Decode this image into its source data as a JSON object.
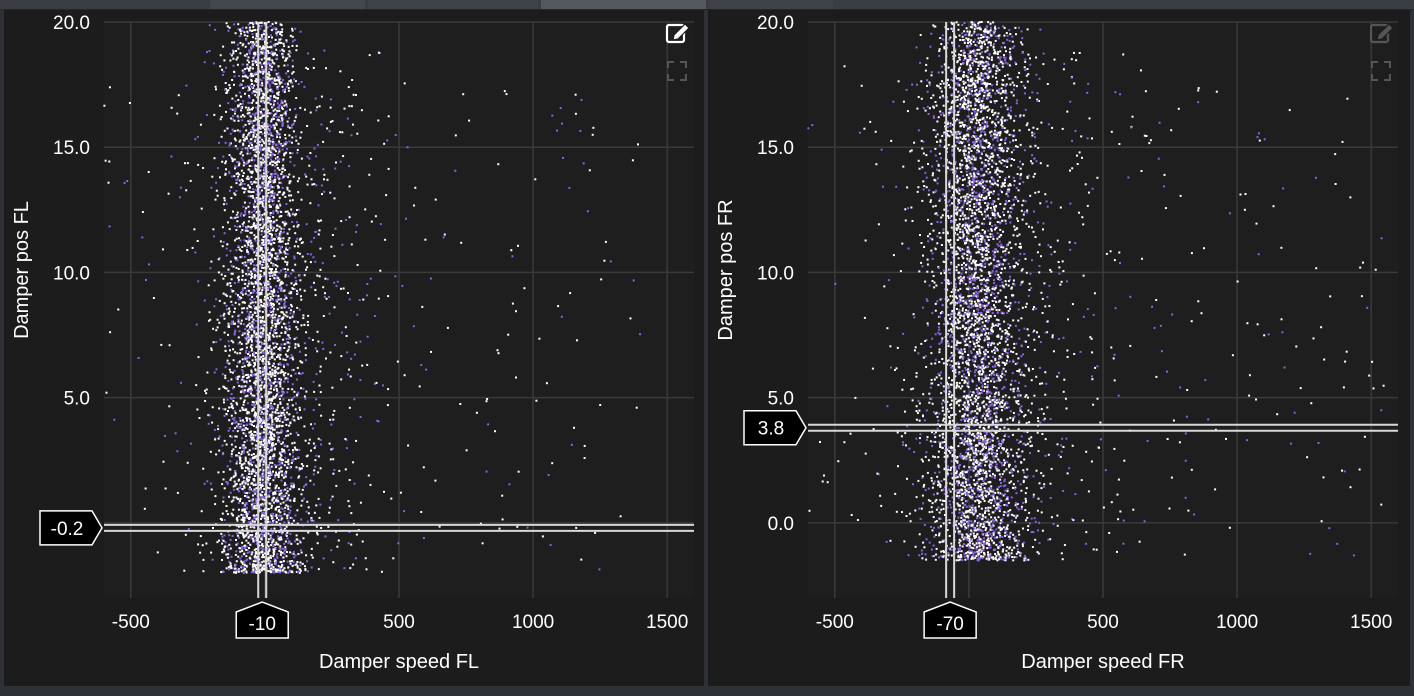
{
  "colors": {
    "background": "#1c1c1c",
    "grid": "#3a3a3a",
    "text": "#ffffff",
    "point_primary": "#ffffff",
    "point_secondary": "#8a63e0",
    "cursor_line": "#d8d8d8"
  },
  "toolbar_icons": [
    "edit-icon",
    "fullscreen-icon"
  ],
  "chart_data": [
    {
      "type": "scatter",
      "xlabel": "Damper speed FL",
      "ylabel": "Damper pos FL",
      "xlim": [
        -600,
        1600
      ],
      "ylim": [
        -3,
        20
      ],
      "xticks": [
        -500,
        0,
        500,
        1000,
        1500
      ],
      "xtick_labels": [
        "-500",
        "",
        "500",
        "1000",
        "1500"
      ],
      "yticks": [
        0,
        5,
        10,
        15,
        20
      ],
      "ytick_labels": [
        "",
        "5.0",
        "10.0",
        "15.0",
        "20.0"
      ],
      "grid": true,
      "cursor": {
        "x": -10,
        "y": -0.2,
        "x_label": "-10",
        "y_label": "-0.2"
      },
      "distribution": {
        "center_x": -10,
        "spread_x": 60,
        "y_min": -2,
        "y_max": 20,
        "outlier_x_max": 1400
      },
      "series": [
        {
          "color": "#ffffff"
        },
        {
          "color": "#8a63e0"
        }
      ]
    },
    {
      "type": "scatter",
      "xlabel": "Damper speed FR",
      "ylabel": "Damper pos FR",
      "xlim": [
        -600,
        1600
      ],
      "ylim": [
        -3,
        20
      ],
      "xticks": [
        -500,
        0,
        500,
        1000,
        1500
      ],
      "xtick_labels": [
        "-500",
        "",
        "500",
        "1000",
        "1500"
      ],
      "yticks": [
        0,
        5,
        10,
        15,
        20
      ],
      "ytick_labels": [
        "0.0",
        "5.0",
        "10.0",
        "15.0",
        "20.0"
      ],
      "grid": true,
      "cursor": {
        "x": -70,
        "y": 3.8,
        "x_label": "-70",
        "y_label": "3.8"
      },
      "distribution": {
        "center_x": 30,
        "spread_x": 80,
        "y_min": -1.5,
        "y_max": 20,
        "outlier_x_max": 1550
      },
      "series": [
        {
          "color": "#ffffff"
        },
        {
          "color": "#8a63e0"
        }
      ]
    }
  ]
}
